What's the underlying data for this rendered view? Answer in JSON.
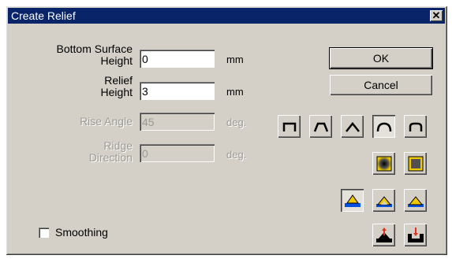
{
  "window": {
    "title": "Create Relief",
    "close_glyph": "✕"
  },
  "fields": {
    "bottom_surface_height": {
      "label_line1": "Bottom Surface",
      "label_line2": "Height",
      "value": "0",
      "unit": "mm",
      "enabled": true
    },
    "relief_height": {
      "label_line1": "Relief",
      "label_line2": "Height",
      "value": "3",
      "unit": "mm",
      "enabled": true
    },
    "rise_angle": {
      "label": "Rise Angle",
      "value": "45",
      "unit": "deg.",
      "enabled": false
    },
    "ridge_direction": {
      "label_line1": "Ridge",
      "label_line2": "Direction",
      "value": "0",
      "unit": "deg.",
      "enabled": false
    }
  },
  "buttons": {
    "ok": "OK",
    "cancel": "Cancel"
  },
  "profile_shapes": {
    "items": [
      "square-profile",
      "trapezoid-profile",
      "triangle-profile",
      "round-profile",
      "rounded-rect-profile"
    ],
    "selected": "round-profile"
  },
  "fill_styles": {
    "items": [
      "gradient-fill",
      "flat-fill"
    ]
  },
  "base_modes": {
    "items": [
      "base-mode-1",
      "base-mode-2",
      "base-mode-3"
    ],
    "selected": "base-mode-1"
  },
  "direction_modes": {
    "items": [
      "raise-up",
      "push-down"
    ]
  },
  "smoothing": {
    "label": "Smoothing",
    "checked": false
  },
  "colors": {
    "title_bar": "#0a246a",
    "dialog_bg": "#d4d0c8",
    "icon_yellow": "#f0c800",
    "icon_blue": "#0050e0",
    "icon_red": "#e03020"
  }
}
